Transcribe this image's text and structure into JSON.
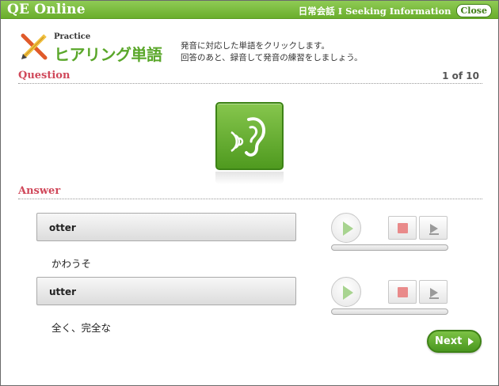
{
  "titlebar": {
    "app_title": "QE Online",
    "lesson": "日常会話 I Seeking Information",
    "close_label": "Close"
  },
  "header": {
    "small_label": "Practice",
    "title": "ヒアリング単語",
    "instruction_line1": "発音に対応した単語をクリックします。",
    "instruction_line2": "回答のあと、録音して発音の練習をしましょう。",
    "icon": "pencil-cross-icon"
  },
  "question": {
    "label": "Question",
    "counter": "1 of 10",
    "sound_icon": "ear-sound-icon"
  },
  "answer": {
    "label": "Answer",
    "options": [
      {
        "word": "otter",
        "meaning": "かわうそ"
      },
      {
        "word": "utter",
        "meaning": "全く、完全な"
      }
    ]
  },
  "recording_controls": {
    "play_icon": "play-icon",
    "stop_icon": "stop-icon",
    "playback_icon": "playback-icon"
  },
  "next_button": {
    "label": "Next"
  },
  "colors": {
    "brand_green": "#6aae2c",
    "section_red": "#d0485a",
    "stop_red": "#e98a8a"
  }
}
